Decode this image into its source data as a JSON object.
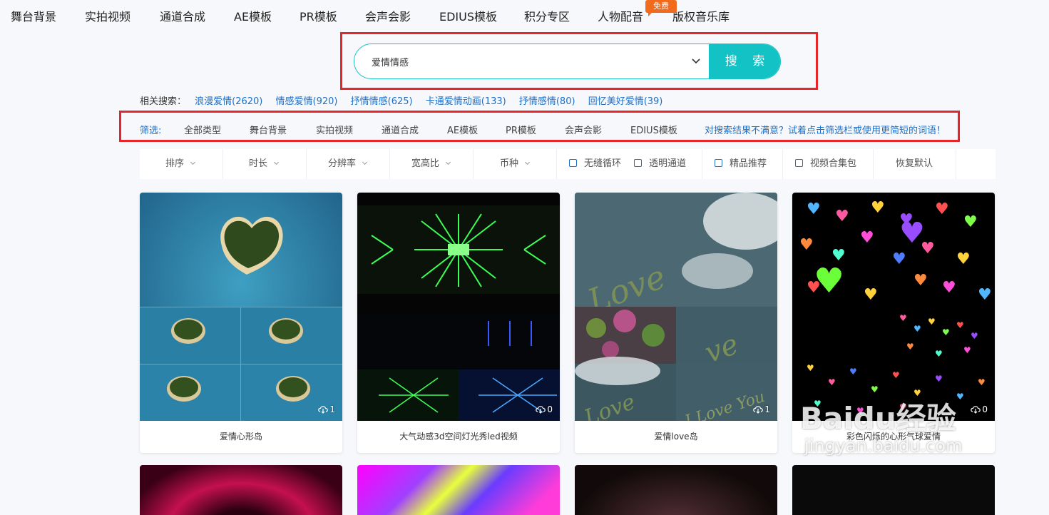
{
  "nav": {
    "items": [
      "舞台背景",
      "实拍视频",
      "通道合成",
      "AE模板",
      "PR模板",
      "会声会影",
      "EDIUS模板",
      "积分专区",
      "人物配音",
      "版权音乐库"
    ],
    "badge": "免费"
  },
  "search": {
    "value": "爱情情感",
    "button": "搜 索"
  },
  "related": {
    "label": "相关搜索：",
    "links": [
      "浪漫爱情(2620)",
      "情感爱情(920)",
      "抒情情感(625)",
      "卡通爱情动画(133)",
      "抒情感情(80)",
      "回忆美好爱情(39)"
    ]
  },
  "filter": {
    "label": "筛选:",
    "types": [
      "全部类型",
      "舞台背景",
      "实拍视频",
      "通道合成",
      "AE模板",
      "PR模板",
      "会声会影",
      "EDIUS模板"
    ],
    "tip": "对搜索结果不满意？试着点击筛选栏或使用更简短的词语！"
  },
  "sort": {
    "dropdowns": [
      "排序",
      "时长",
      "分辨率",
      "宽高比",
      "币种"
    ],
    "checks": [
      "无缝循环",
      "透明通道",
      "精品推荐",
      "视频合集包"
    ],
    "reset": "恢复默认"
  },
  "cards": [
    {
      "title": "爱情心形岛",
      "downloads": "1"
    },
    {
      "title": "大气动感3d空间灯光秀led视频",
      "downloads": "0"
    },
    {
      "title": "爱情love岛",
      "downloads": "1"
    },
    {
      "title": "彩色闪烁的心形气球爱情",
      "downloads": "0"
    }
  ],
  "watermark": {
    "brand": "Baidu经验",
    "url": "jingyan.baidu.com"
  },
  "colors": {
    "accent": "#13c2c5",
    "link": "#1c6fc9",
    "highlight": "#e4262b",
    "badge": "#f26b1d"
  }
}
